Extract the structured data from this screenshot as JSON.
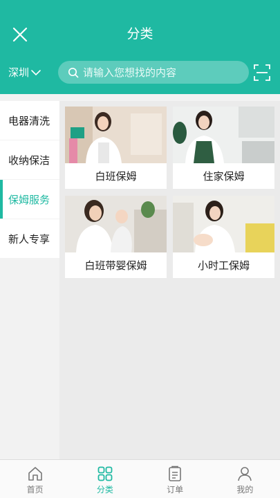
{
  "header": {
    "title": "分类",
    "city": "深圳"
  },
  "search": {
    "placeholder": "请输入您想找的内容"
  },
  "sidebar": {
    "items": [
      {
        "label": "电器清洗"
      },
      {
        "label": "收纳保洁"
      },
      {
        "label": "保姆服务"
      },
      {
        "label": "新人专享"
      }
    ]
  },
  "services": [
    {
      "label": "白班保姆"
    },
    {
      "label": "住家保姆"
    },
    {
      "label": "白班带婴保姆"
    },
    {
      "label": "小时工保姆"
    }
  ],
  "tabbar": {
    "items": [
      {
        "label": "首页",
        "icon": "home-icon"
      },
      {
        "label": "分类",
        "icon": "grid-icon"
      },
      {
        "label": "订单",
        "icon": "clipboard-icon"
      },
      {
        "label": "我的",
        "icon": "user-icon"
      }
    ]
  },
  "colors": {
    "accent": "#1fb9a2"
  }
}
